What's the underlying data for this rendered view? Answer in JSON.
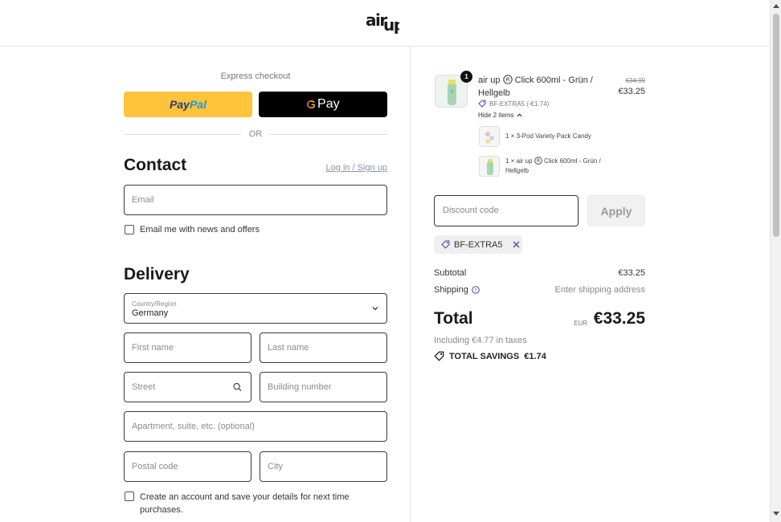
{
  "brand": {
    "logo_text": "air up"
  },
  "express": {
    "label": "Express checkout",
    "paypal_part1": "Pay",
    "paypal_part2": "Pal",
    "gpay_g": "G",
    "gpay_text": "Pay",
    "or_text": "OR"
  },
  "contact": {
    "heading": "Contact",
    "login_link": "Log in / Sign up",
    "email_placeholder": "Email",
    "newsletter_label": "Email me with news and offers"
  },
  "delivery": {
    "heading": "Delivery",
    "country_label": "Country/Region",
    "country_value": "Germany",
    "first_name_placeholder": "First name",
    "last_name_placeholder": "Last name",
    "street_placeholder": "Street",
    "building_placeholder": "Building number",
    "apartment_placeholder": "Apartment, suite, etc. (optional)",
    "postal_placeholder": "Postal code",
    "city_placeholder": "City",
    "create_account_line1": "Create an account and save your details for next time",
    "create_account_line2": "purchases."
  },
  "order": {
    "product": {
      "quantity": "1",
      "name_part1": "air up",
      "name_part2": "Click 600ml - Grün /",
      "name_part3": "Hellgelb",
      "original_price": "€34.99",
      "price": "€33.25",
      "discount_line": "BF-EXTRA5 (-€1.74)",
      "hide_items_label": "Hide 2 items"
    },
    "sub_items": [
      {
        "text_line1": "1 × 3-Pod Variety Pack Candy",
        "text_line2": ""
      },
      {
        "text_line1": "1 × air up",
        "text_line1b": "Click 600ml - Grün /",
        "text_line2": "Hellgelb"
      }
    ],
    "discount_placeholder": "Discount code",
    "apply_label": "Apply",
    "applied_code": "BF-EXTRA5",
    "subtotal_label": "Subtotal",
    "subtotal_value": "€33.25",
    "shipping_label": "Shipping",
    "shipping_value": "Enter shipping address",
    "total_label": "Total",
    "currency": "EUR",
    "total_value": "€33.25",
    "tax_line": "Including €4.77 in taxes",
    "savings_line": "TOTAL SAVINGS  €1.74"
  },
  "colors": {
    "paypal_yellow": "#ffc439",
    "accent_purple": "#6b3fa0",
    "border_dark": "#3a3a3a"
  }
}
